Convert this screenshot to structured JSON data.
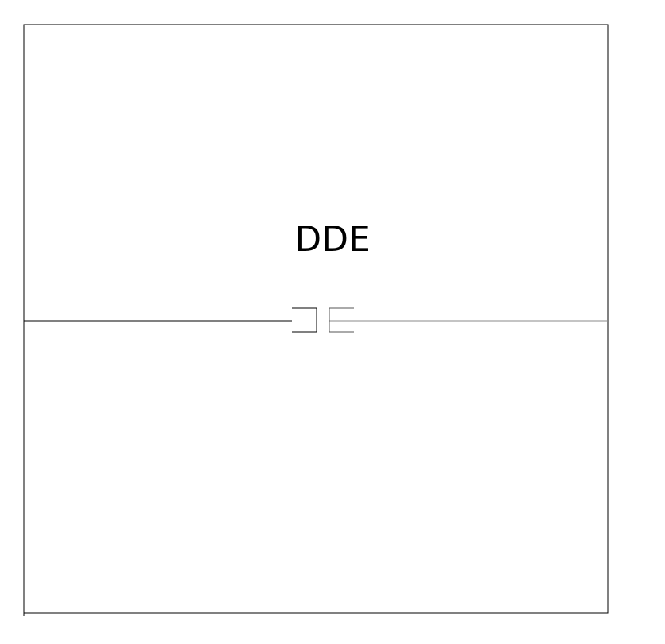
{
  "diagram": {
    "label": "DDE",
    "colors": {
      "background": "#ffffff",
      "line": "#000000",
      "secondary_line": "#888888"
    }
  }
}
